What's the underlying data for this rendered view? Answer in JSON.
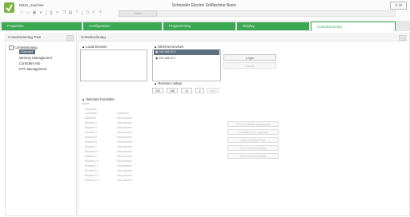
{
  "window": {
    "project": "M241_machine",
    "title": "Schneider Electric SoMachine Basic",
    "control": "-|□|x"
  },
  "toolbar": {
    "icons": [
      "new-icon",
      "open-icon",
      "save-icon",
      "save-dropdown-icon",
      "print-icon",
      "cut-icon",
      "copy-icon",
      "paste-icon",
      "help-icon",
      "build-icon",
      "undo-icon",
      "redo-icon"
    ],
    "offline_label": "Offline"
  },
  "tabs": [
    "Properties",
    "Configuration",
    "Programming",
    "Display",
    "Commissioning"
  ],
  "active_tab": "Commissioning",
  "sidebar": {
    "title": "Commissioning Tree",
    "root": "Commissioning",
    "items": [
      "Connect",
      "Memory Management",
      "Controller Info",
      "RTC Management"
    ]
  },
  "main": {
    "title": "Commissioning",
    "local_devices": {
      "label": "Local Devices"
    },
    "ethernet_devices": {
      "label": "Ethernet Devices",
      "rows": [
        "192.168.10.2",
        "192.168.10.1"
      ]
    },
    "buttons": {
      "login": "Login",
      "cancel": "Cancel"
    },
    "remote_lookup": {
      "label": "Remote Lookup",
      "ip": [
        "192",
        "168",
        "10",
        "2"
      ],
      "add": "Add"
    },
    "selected_controller": {
      "label": "Selected Controller",
      "name_label": "Name",
      "firmware_label": "Firmware",
      "col_left": "Controller",
      "col_right": "Unknown",
      "modules": [
        {
          "name": "Module 1",
          "status": "Not present"
        },
        {
          "name": "Module 2",
          "status": "Not present"
        },
        {
          "name": "Module 3",
          "status": "Not present"
        },
        {
          "name": "Module 4",
          "status": "Not present"
        },
        {
          "name": "Module 5",
          "status": "Not present"
        },
        {
          "name": "Module 6",
          "status": "Not present"
        },
        {
          "name": "Module 7",
          "status": "Not present"
        },
        {
          "name": "Module 8",
          "status": "Not present"
        },
        {
          "name": "Module 9",
          "status": "Not present"
        },
        {
          "name": "Module 10",
          "status": "Not present"
        },
        {
          "name": "Module 11",
          "status": "Not present"
        },
        {
          "name": "Module 12",
          "status": "Not present"
        },
        {
          "name": "Module 13",
          "status": "Not present"
        },
        {
          "name": "Module 14",
          "status": "Not present"
        }
      ]
    },
    "actions": [
      "PC to Controller (download)",
      "Controller to PC (upload)",
      "Start Controller/Stop",
      "Stop controller (Stop)",
      "Start controller (Start)"
    ]
  },
  "colors": {
    "accent": "#3aa852",
    "selection": "#5f6f82"
  }
}
